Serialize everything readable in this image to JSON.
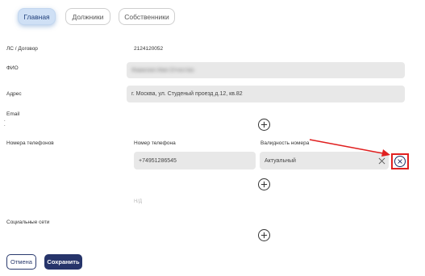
{
  "tabs": [
    {
      "label": "Главная",
      "active": true
    },
    {
      "label": "Должники",
      "active": false
    },
    {
      "label": "Собственники",
      "active": false
    }
  ],
  "account": {
    "label": "ЛС / Договор",
    "value": "2124120052"
  },
  "fio": {
    "label": "ФИО",
    "value": "Фамилия Имя Отчество"
  },
  "address": {
    "label": "Адрес",
    "value": "г. Москва, ул. Студеный проезд д.12, кв.82"
  },
  "email": {
    "label": "Email"
  },
  "phones": {
    "label": "Номера телефонов",
    "col_number": "Номер телефона",
    "col_validity": "Валидность номера",
    "rows": [
      {
        "number": "+74951286545",
        "validity": "Актуальный"
      }
    ],
    "nd": "Н/Д"
  },
  "social": {
    "label": "Социальные сети"
  },
  "actions": {
    "cancel": "Отмена",
    "save": "Сохранить"
  },
  "colors": {
    "accent": "#26346a",
    "highlight": "#e02020",
    "field_bg": "#e8e8e8"
  },
  "icons": {
    "add": "plus-circle-icon",
    "clear": "close-icon",
    "remove": "remove-circle-icon",
    "arrow": "annotation-arrow"
  }
}
